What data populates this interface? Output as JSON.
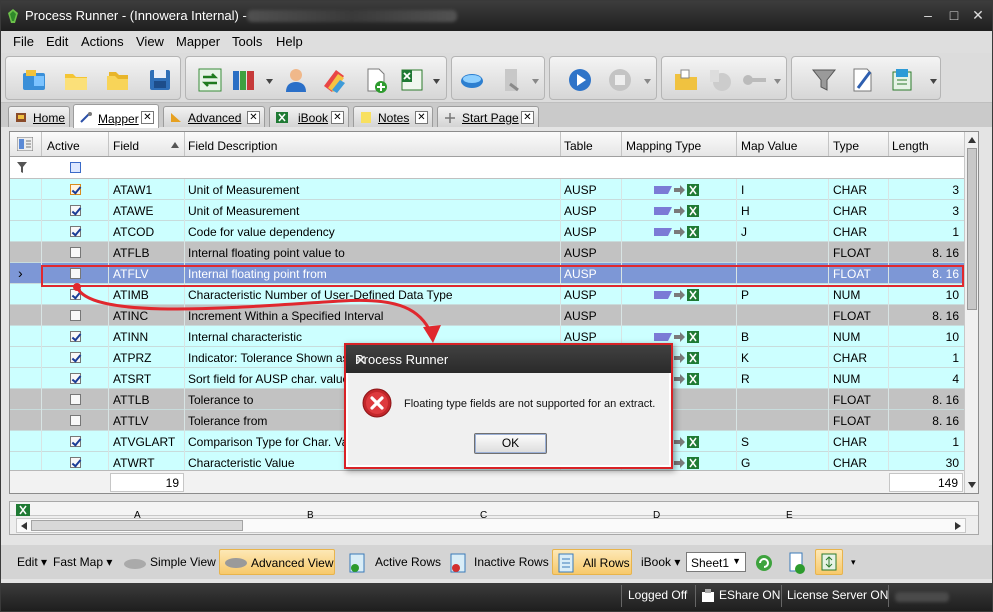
{
  "window": {
    "title": "Process Runner - (Innowera Internal) -",
    "buttons": {
      "minimize": "–",
      "maximize": "□",
      "close": "✕"
    }
  },
  "menu": [
    "File",
    "Edit",
    "Actions",
    "View",
    "Mapper",
    "Tools",
    "Help"
  ],
  "tabs": [
    {
      "label": "Home",
      "closable": false,
      "icon": "home-icon"
    },
    {
      "label": "Mapper",
      "closable": true,
      "active": true,
      "icon": "mapper-icon"
    },
    {
      "label": "Advanced",
      "closable": true,
      "icon": "advanced-icon"
    },
    {
      "label": "iBook",
      "closable": true,
      "icon": "ibook-icon"
    },
    {
      "label": "Notes",
      "closable": true,
      "icon": "notes-icon"
    },
    {
      "label": "Start Page",
      "closable": true,
      "icon": "start-page-icon"
    }
  ],
  "grid": {
    "columns": [
      "Active",
      "Field",
      "Field Description",
      "Table",
      "Mapping Type",
      "Map Value",
      "Type",
      "Length"
    ],
    "rows": [
      {
        "active": true,
        "checkbox_style": "orange",
        "field": "ATAW1",
        "desc": "Unit of Measurement",
        "table": "AUSP",
        "mapped": true,
        "map_value": "I",
        "type": "CHAR",
        "length": "3",
        "style": "cyan"
      },
      {
        "active": true,
        "field": "ATAWE",
        "desc": "Unit of Measurement",
        "table": "AUSP",
        "mapped": true,
        "map_value": "H",
        "type": "CHAR",
        "length": "3",
        "style": "cyan"
      },
      {
        "active": true,
        "field": "ATCOD",
        "desc": "Code for value dependency",
        "table": "AUSP",
        "mapped": true,
        "map_value": "J",
        "type": "CHAR",
        "length": "1",
        "style": "cyan"
      },
      {
        "active": false,
        "field": "ATFLB",
        "desc": "Internal floating point value to",
        "table": "AUSP",
        "mapped": false,
        "map_value": "",
        "type": "FLOAT",
        "length": "8. 16",
        "style": "gray"
      },
      {
        "active": false,
        "field": "ATFLV",
        "desc": "Internal floating point from",
        "table": "AUSP",
        "mapped": false,
        "map_value": "",
        "type": "FLOAT",
        "length": "8. 16",
        "style": "sel",
        "current": true
      },
      {
        "active": true,
        "field": "ATIMB",
        "desc": "Characteristic Number of User-Defined Data Type",
        "table": "AUSP",
        "mapped": true,
        "map_value": "P",
        "type": "NUM",
        "length": "10",
        "style": "cyan"
      },
      {
        "active": false,
        "field": "ATINC",
        "desc": "Increment Within a Specified Interval",
        "table": "AUSP",
        "mapped": false,
        "map_value": "",
        "type": "FLOAT",
        "length": "8. 16",
        "style": "gray"
      },
      {
        "active": true,
        "field": "ATINN",
        "desc": "Internal characteristic",
        "table": "AUSP",
        "mapped": true,
        "map_value": "B",
        "type": "NUM",
        "length": "10",
        "style": "cyan"
      },
      {
        "active": true,
        "field": "ATPRZ",
        "desc": "Indicator: Tolerance Shown as a",
        "table": "AUSP",
        "mapped": true,
        "map_value": "K",
        "type": "CHAR",
        "length": "1",
        "style": "cyan"
      },
      {
        "active": true,
        "field": "ATSRT",
        "desc": "Sort field for AUSP char. values",
        "table": "AUSP",
        "mapped": true,
        "map_value": "R",
        "type": "NUM",
        "length": "4",
        "style": "cyan"
      },
      {
        "active": false,
        "field": "ATTLB",
        "desc": "Tolerance to",
        "table": "AUSP",
        "mapped": false,
        "map_value": "",
        "type": "FLOAT",
        "length": "8. 16",
        "style": "gray"
      },
      {
        "active": false,
        "field": "ATTLV",
        "desc": "Tolerance from",
        "table": "AUSP",
        "mapped": false,
        "map_value": "",
        "type": "FLOAT",
        "length": "8. 16",
        "style": "gray"
      },
      {
        "active": true,
        "field": "ATVGLART",
        "desc": "Comparison Type for Char. Value",
        "table": "AUSP",
        "mapped": true,
        "map_value": "S",
        "type": "CHAR",
        "length": "1",
        "style": "cyan"
      },
      {
        "active": true,
        "field": "ATWRT",
        "desc": "Characteristic Value",
        "table": "AUSP",
        "mapped": true,
        "map_value": "G",
        "type": "CHAR",
        "length": "30",
        "style": "cyan"
      }
    ],
    "footer": {
      "count": "19",
      "length_total": "149"
    }
  },
  "sheet": {
    "columns": [
      "A",
      "B",
      "C",
      "D",
      "E"
    ]
  },
  "dialog": {
    "title": "Process Runner",
    "message": "Floating type fields are not supported for an extract.",
    "ok_label": "OK",
    "icon": "error-icon"
  },
  "bottom_toolbar": {
    "edit": "Edit",
    "fast_map": "Fast Map",
    "simple_view": "Simple View",
    "advanced_view": "Advanced View",
    "active_rows": "Active Rows",
    "inactive_rows": "Inactive Rows",
    "all_rows": "All Rows",
    "ibook": "iBook",
    "sheet_select": "Sheet1"
  },
  "status": {
    "logged": "Logged Off",
    "eshare": "EShare ON",
    "license": "License Server ON"
  },
  "colors": {
    "cyan_row": "#ccffff",
    "gray_row": "#c2c2c2",
    "selected_row": "#7d97d6",
    "highlight_red": "#e0282e",
    "active_toggle": "#f7c96b"
  }
}
